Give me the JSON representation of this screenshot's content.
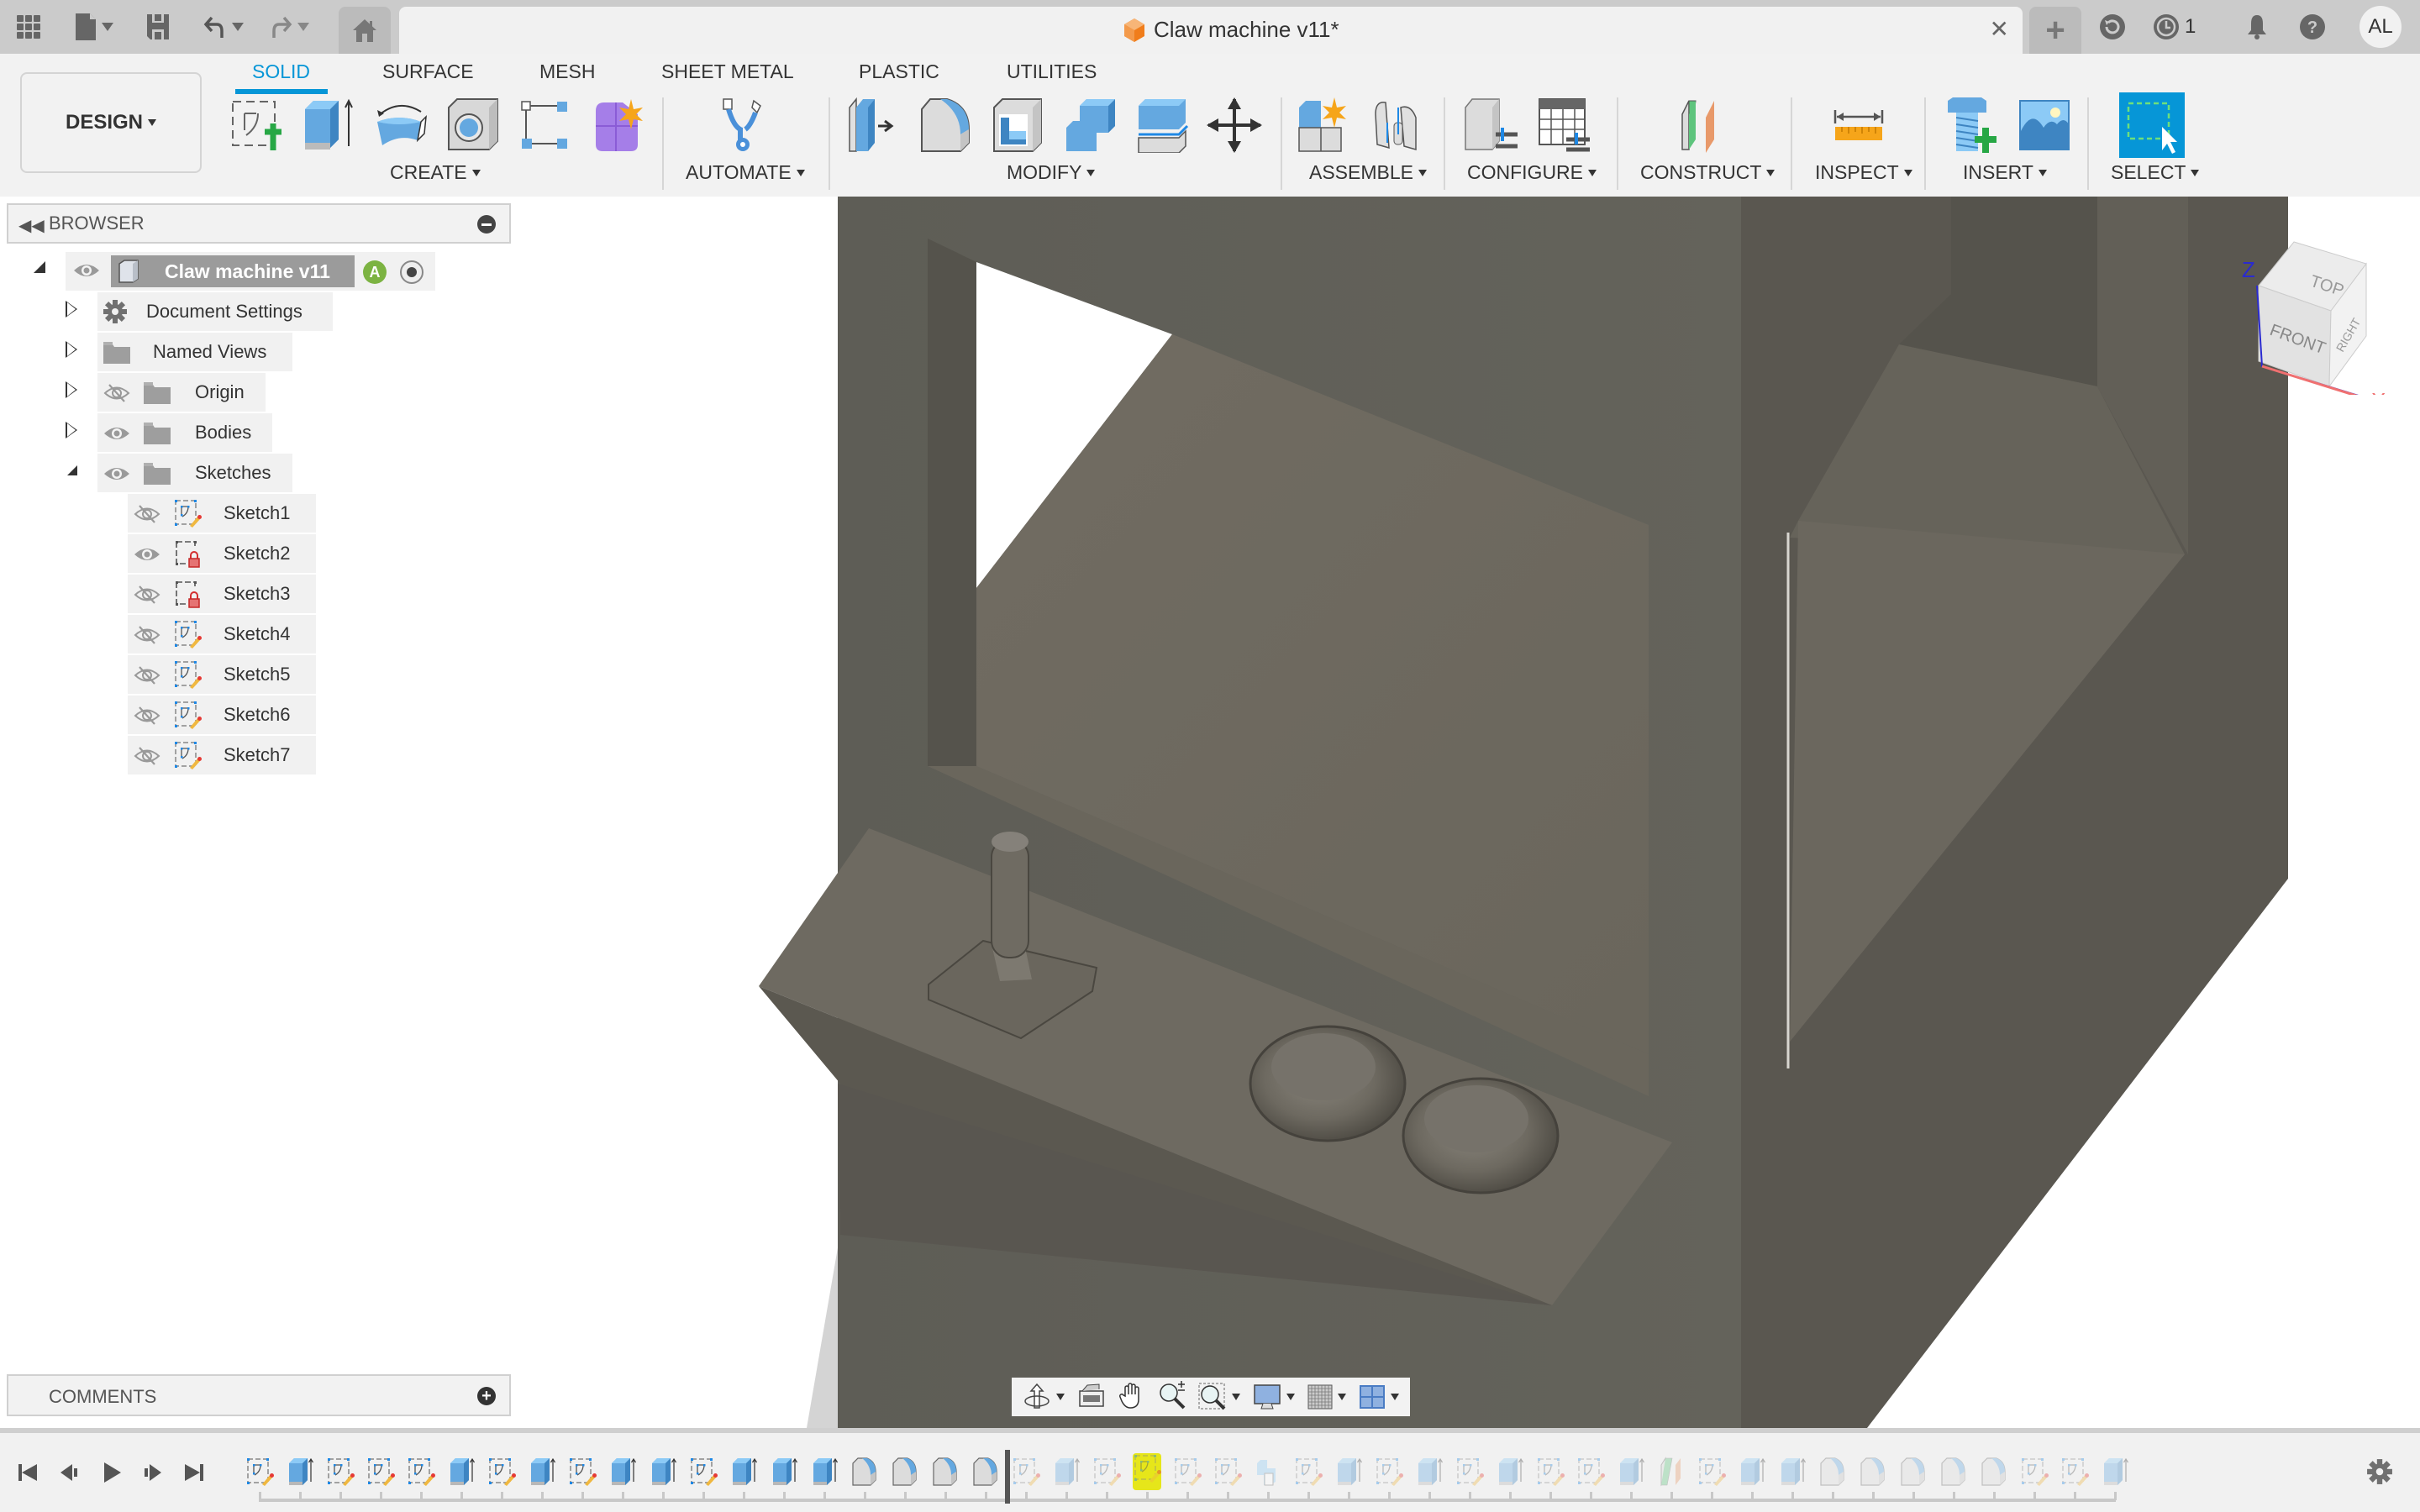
{
  "app": {
    "document_title": "Claw machine v11*",
    "notifications_job_count": "1",
    "user_initials": "AL"
  },
  "topbar": {
    "icons": [
      "apps-grid-icon",
      "file-icon",
      "save-icon",
      "undo-icon",
      "redo-icon",
      "home-icon"
    ],
    "right_icons": [
      "new-tab-icon",
      "refresh-icon",
      "job-status-icon",
      "notifications-bell-icon",
      "help-icon"
    ]
  },
  "toolbar": {
    "workspace": "DESIGN",
    "tabs": [
      {
        "label": "SOLID",
        "active": true
      },
      {
        "label": "SURFACE",
        "active": false
      },
      {
        "label": "MESH",
        "active": false
      },
      {
        "label": "SHEET METAL",
        "active": false
      },
      {
        "label": "PLASTIC",
        "active": false
      },
      {
        "label": "UTILITIES",
        "active": false
      }
    ],
    "groups": [
      {
        "label": "CREATE",
        "tools": [
          "create-sketch",
          "extrude",
          "revolve",
          "hole",
          "pattern",
          "create-form"
        ]
      },
      {
        "label": "AUTOMATE",
        "tools": [
          "automate"
        ]
      },
      {
        "label": "MODIFY",
        "tools": [
          "press-pull",
          "fillet",
          "shell",
          "combine",
          "split-body",
          "move-copy"
        ]
      },
      {
        "label": "ASSEMBLE",
        "tools": [
          "new-component",
          "joint"
        ]
      },
      {
        "label": "CONFIGURE",
        "tools": [
          "configure",
          "configuration-table"
        ]
      },
      {
        "label": "CONSTRUCT",
        "tools": [
          "offset-plane"
        ]
      },
      {
        "label": "INSPECT",
        "tools": [
          "measure"
        ]
      },
      {
        "label": "INSERT",
        "tools": [
          "insert-mcmaster",
          "insert-canvas"
        ]
      },
      {
        "label": "SELECT",
        "tools": [
          "window-select"
        ]
      }
    ]
  },
  "browser": {
    "title": "BROWSER",
    "root": {
      "label": "Claw machine v11",
      "badge": "A"
    },
    "items": [
      {
        "label": "Document Settings",
        "icon": "gear-icon",
        "visible": null
      },
      {
        "label": "Named Views",
        "icon": "folder-icon",
        "visible": null
      },
      {
        "label": "Origin",
        "icon": "folder-icon",
        "visible": false
      },
      {
        "label": "Bodies",
        "icon": "folder-icon",
        "visible": true
      },
      {
        "label": "Sketches",
        "icon": "folder-icon",
        "visible": true,
        "expanded": true
      }
    ],
    "sketches": [
      {
        "label": "Sketch1",
        "visible": false,
        "locked": false
      },
      {
        "label": "Sketch2",
        "visible": true,
        "locked": true
      },
      {
        "label": "Sketch3",
        "visible": false,
        "locked": true
      },
      {
        "label": "Sketch4",
        "visible": false,
        "locked": false
      },
      {
        "label": "Sketch5",
        "visible": false,
        "locked": false
      },
      {
        "label": "Sketch6",
        "visible": false,
        "locked": false
      },
      {
        "label": "Sketch7",
        "visible": false,
        "locked": false
      }
    ]
  },
  "comments": {
    "title": "COMMENTS"
  },
  "viewcube": {
    "top": "TOP",
    "front": "FRONT",
    "right": "RIGHT",
    "axis_z": "Z",
    "axis_x": "X"
  },
  "navbar": {
    "icons": [
      "orbit-icon",
      "look-at-icon",
      "pan-icon",
      "zoom-icon",
      "fit-icon",
      "display-settings-icon",
      "grid-settings-icon",
      "viewports-icon"
    ]
  },
  "timeline": {
    "controls": [
      "go-to-start",
      "step-back",
      "play",
      "step-forward",
      "go-to-end"
    ],
    "features_active": [
      "sketch",
      "extrude",
      "sketch",
      "sketch",
      "sketch",
      "extrude",
      "sketch",
      "extrude",
      "sketch",
      "extrude",
      "extrude",
      "sketch",
      "extrude",
      "extrude",
      "extrude",
      "fillet",
      "fillet",
      "fillet",
      "fillet"
    ],
    "features_suppressed": [
      "sketch",
      "extrude",
      "sketch",
      "sketch",
      "sketch",
      "sketch",
      "combine",
      "sketch",
      "extrude",
      "sketch",
      "extrude",
      "sketch",
      "extrude",
      "sketch",
      "sketch",
      "extrude",
      "plane",
      "sketch",
      "extrude",
      "extrude",
      "fillet",
      "fillet",
      "fillet",
      "fillet",
      "fillet",
      "sketch",
      "sketch",
      "extrude"
    ],
    "highlighted_suppressed_index": 3
  },
  "colors": {
    "accent": "#0696d7",
    "toolbar_bg": "#f2f2f2",
    "topbar_bg": "#cbcbcb",
    "model_body": "#5b5850",
    "timeline_highlight": "#e6e61a"
  }
}
